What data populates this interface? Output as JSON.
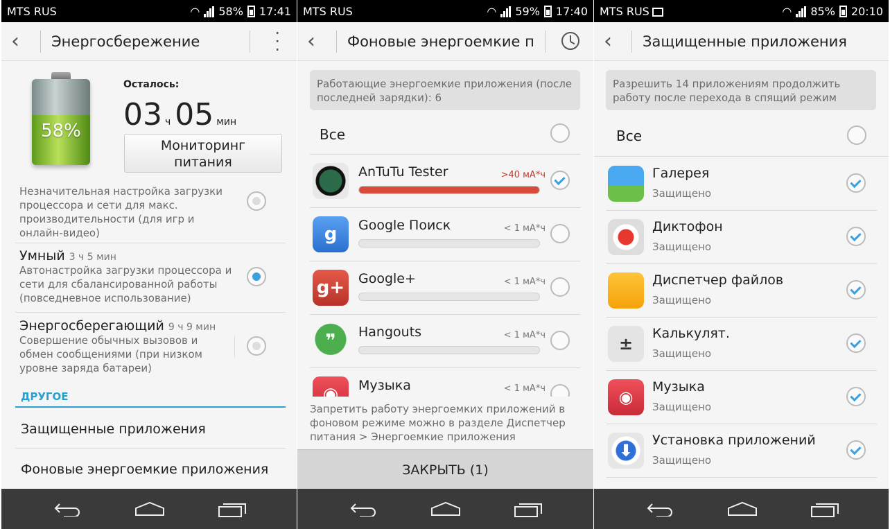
{
  "screens": [
    {
      "status": {
        "carrier": "MTS RUS",
        "battery": "58%",
        "time": "17:41"
      },
      "title": "Энергосбережение",
      "battery_percent": "58%",
      "battery_level": 0.58,
      "remaining_label": "Осталось:",
      "remaining_hours": "03",
      "hours_unit": "ч",
      "remaining_minutes": "05",
      "minutes_unit": "мин",
      "monitor_button_line1": "Мониторинг",
      "monitor_button_line2": "питания",
      "modes": [
        {
          "name": "",
          "time": "",
          "desc": "Незначительная настройка загрузки процессора и сети для макс. производительности (для игр и онлайн-видео)",
          "selected": false
        },
        {
          "name": "Умный",
          "time": "3 ч 5 мин",
          "desc": "Автонастройка загрузки процессора и сети для сбалансированной работы (повседневное использование)",
          "selected": true
        },
        {
          "name": "Энергосберегающий",
          "time": "9 ч 9 мин",
          "desc": "Совершение обычных вызовов и обмен сообщениями (при низком уровне заряда батареи)",
          "selected": false
        }
      ],
      "section_other": "ДРУГОЕ",
      "menu": [
        "Защищенные приложения",
        "Фоновые энергоемкие приложения"
      ]
    },
    {
      "status": {
        "carrier": "MTS RUS",
        "battery": "59%",
        "time": "17:40"
      },
      "title": "Фоновые энергоемкие при",
      "info": "Работающие энергоемкие приложения (после последней зарядки): 6",
      "all_label": "Все",
      "apps": [
        {
          "name": "AnTuTu Tester",
          "usage": ">40 мА*ч",
          "level": 1.0,
          "checked": true,
          "icon": "antutu-icon"
        },
        {
          "name": "Google Поиск",
          "usage": "< 1 мА*ч",
          "level": 0.0,
          "checked": false,
          "icon": "google-search-icon"
        },
        {
          "name": "Google+",
          "usage": "< 1 мА*ч",
          "level": 0.0,
          "checked": false,
          "icon": "google-plus-icon"
        },
        {
          "name": "Hangouts",
          "usage": "< 1 мА*ч",
          "level": 0.0,
          "checked": false,
          "icon": "hangouts-icon"
        },
        {
          "name": "Музыка",
          "usage": "< 1 мА*ч",
          "level": 0.0,
          "checked": false,
          "icon": "music-icon"
        }
      ],
      "footer": "Запретить работу энергоемких приложений в фоновом режиме можно в разделе Диспетчер питания > Энергоемкие приложения",
      "close_button": "ЗАКРЫТЬ (1)"
    },
    {
      "status": {
        "carrier": "MTS RUS",
        "battery": "85%",
        "time": "20:10"
      },
      "title": "Защищенные приложения",
      "info": "Разрешить 14 приложениям продолжить работу после перехода в спящий режим",
      "all_label": "Все",
      "apps": [
        {
          "name": "Галерея",
          "sub": "Защищено",
          "checked": true,
          "icon": "gallery-icon"
        },
        {
          "name": "Диктофон",
          "sub": "Защищено",
          "checked": true,
          "icon": "recorder-icon"
        },
        {
          "name": "Диспетчер файлов",
          "sub": "Защищено",
          "checked": true,
          "icon": "files-icon"
        },
        {
          "name": "Калькулят.",
          "sub": "Защищено",
          "checked": true,
          "icon": "calculator-icon"
        },
        {
          "name": "Музыка",
          "sub": "Защищено",
          "checked": true,
          "icon": "music-icon"
        },
        {
          "name": "Установка приложений",
          "sub": "Защищено",
          "checked": true,
          "icon": "installer-icon"
        }
      ]
    }
  ],
  "colors": {
    "accent": "#2aa0d0",
    "check": "#3aa0e0",
    "high_usage": "#c0392b",
    "navbar": "#3a3a3a"
  }
}
